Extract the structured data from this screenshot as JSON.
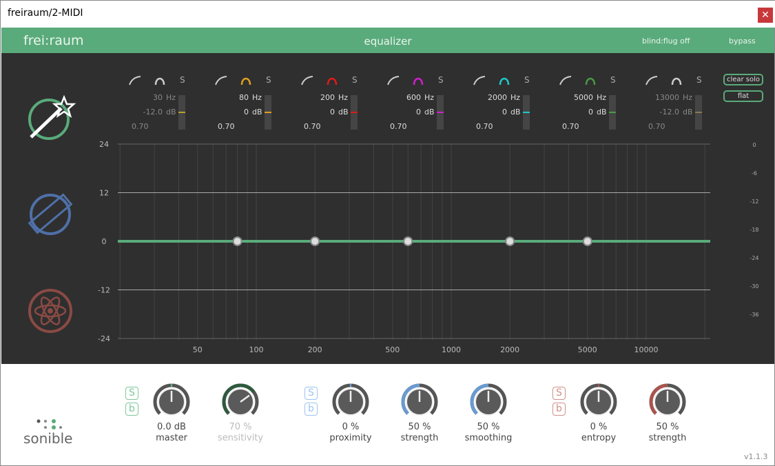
{
  "window": {
    "title": "freiraum/2-MIDI",
    "close": "✕"
  },
  "header": {
    "brand": "frei:raum",
    "title": "equalizer",
    "blind": "blind:flug off",
    "bypass": "bypass"
  },
  "buttons": {
    "clear_solo": "clear solo",
    "flat": "flat"
  },
  "bands": [
    {
      "freq": "30",
      "gain": "-12.0",
      "q": "0.70",
      "hz": "Hz",
      "db": "dB",
      "solo": "S",
      "color": "#b8a030",
      "icon_color": "#cccccc",
      "enabled": false
    },
    {
      "freq": "80",
      "gain": "0",
      "q": "0.70",
      "hz": "Hz",
      "db": "dB",
      "solo": "S",
      "color": "#e0a020",
      "icon_color": "#e0a020",
      "enabled": true
    },
    {
      "freq": "200",
      "gain": "0",
      "q": "0.70",
      "hz": "Hz",
      "db": "dB",
      "solo": "S",
      "color": "#e01a1a",
      "icon_color": "#e01a1a",
      "enabled": true
    },
    {
      "freq": "600",
      "gain": "0",
      "q": "0.70",
      "hz": "Hz",
      "db": "dB",
      "solo": "S",
      "color": "#d020d0",
      "icon_color": "#d020d0",
      "enabled": true
    },
    {
      "freq": "2000",
      "gain": "0",
      "q": "0.70",
      "hz": "Hz",
      "db": "dB",
      "solo": "S",
      "color": "#20c8c8",
      "icon_color": "#20c8c8",
      "enabled": true
    },
    {
      "freq": "5000",
      "gain": "0",
      "q": "0.70",
      "hz": "Hz",
      "db": "dB",
      "solo": "S",
      "color": "#4a9a40",
      "icon_color": "#4a9a40",
      "enabled": true
    },
    {
      "freq": "13000",
      "gain": "-12.0",
      "q": "0.70",
      "hz": "Hz",
      "db": "dB",
      "solo": "S",
      "color": "#8a7a50",
      "icon_color": "#cccccc",
      "enabled": false
    }
  ],
  "graph": {
    "db_ticks": [
      "24",
      "12",
      "0",
      "-12",
      "-24"
    ],
    "freq_ticks": [
      "50",
      "100",
      "200",
      "500",
      "1000",
      "2000",
      "5000",
      "10000"
    ],
    "meter_ticks": [
      "0",
      "-6",
      "-12",
      "-18",
      "-24",
      "-30",
      "-36"
    ],
    "nodes_hz": [
      80,
      200,
      600,
      2000,
      5000
    ],
    "curve_color": "#5aab7b"
  },
  "side_icons": [
    "magic-wand",
    "ruler",
    "atom"
  ],
  "knobs": [
    {
      "value": "0.0 dB",
      "label": "master",
      "pointer": 0.5,
      "fill": false,
      "color": "#5aab7b",
      "muted": false
    },
    {
      "value": "70 %",
      "label": "sensitivity",
      "pointer": 0.7,
      "fill": true,
      "color": "#2f5a3e",
      "muted": true
    },
    {
      "value": "0 %",
      "label": "proximity",
      "pointer": 0.5,
      "fill": false,
      "color": "#6a9ad0",
      "muted": false
    },
    {
      "value": "50 %",
      "label": "strength",
      "pointer": 0.5,
      "fill": true,
      "color": "#6a9ad0",
      "muted": false
    },
    {
      "value": "50 %",
      "label": "smoothing",
      "pointer": 0.5,
      "fill": true,
      "color": "#6a9ad0",
      "muted": false
    },
    {
      "value": "0 %",
      "label": "entropy",
      "pointer": 0.5,
      "fill": false,
      "color": "#a8554e",
      "muted": false
    },
    {
      "value": "50 %",
      "label": "strength",
      "pointer": 0.5,
      "fill": true,
      "color": "#a8554e",
      "muted": false
    }
  ],
  "sb_groups": [
    {
      "s": "S",
      "b": "b",
      "color": "#7cc89a"
    },
    {
      "s": "S",
      "b": "b",
      "color": "#9cc4f0"
    },
    {
      "s": "S",
      "b": "b",
      "color": "#d09088"
    }
  ],
  "logo": "sonible",
  "version": "v1.1.3"
}
